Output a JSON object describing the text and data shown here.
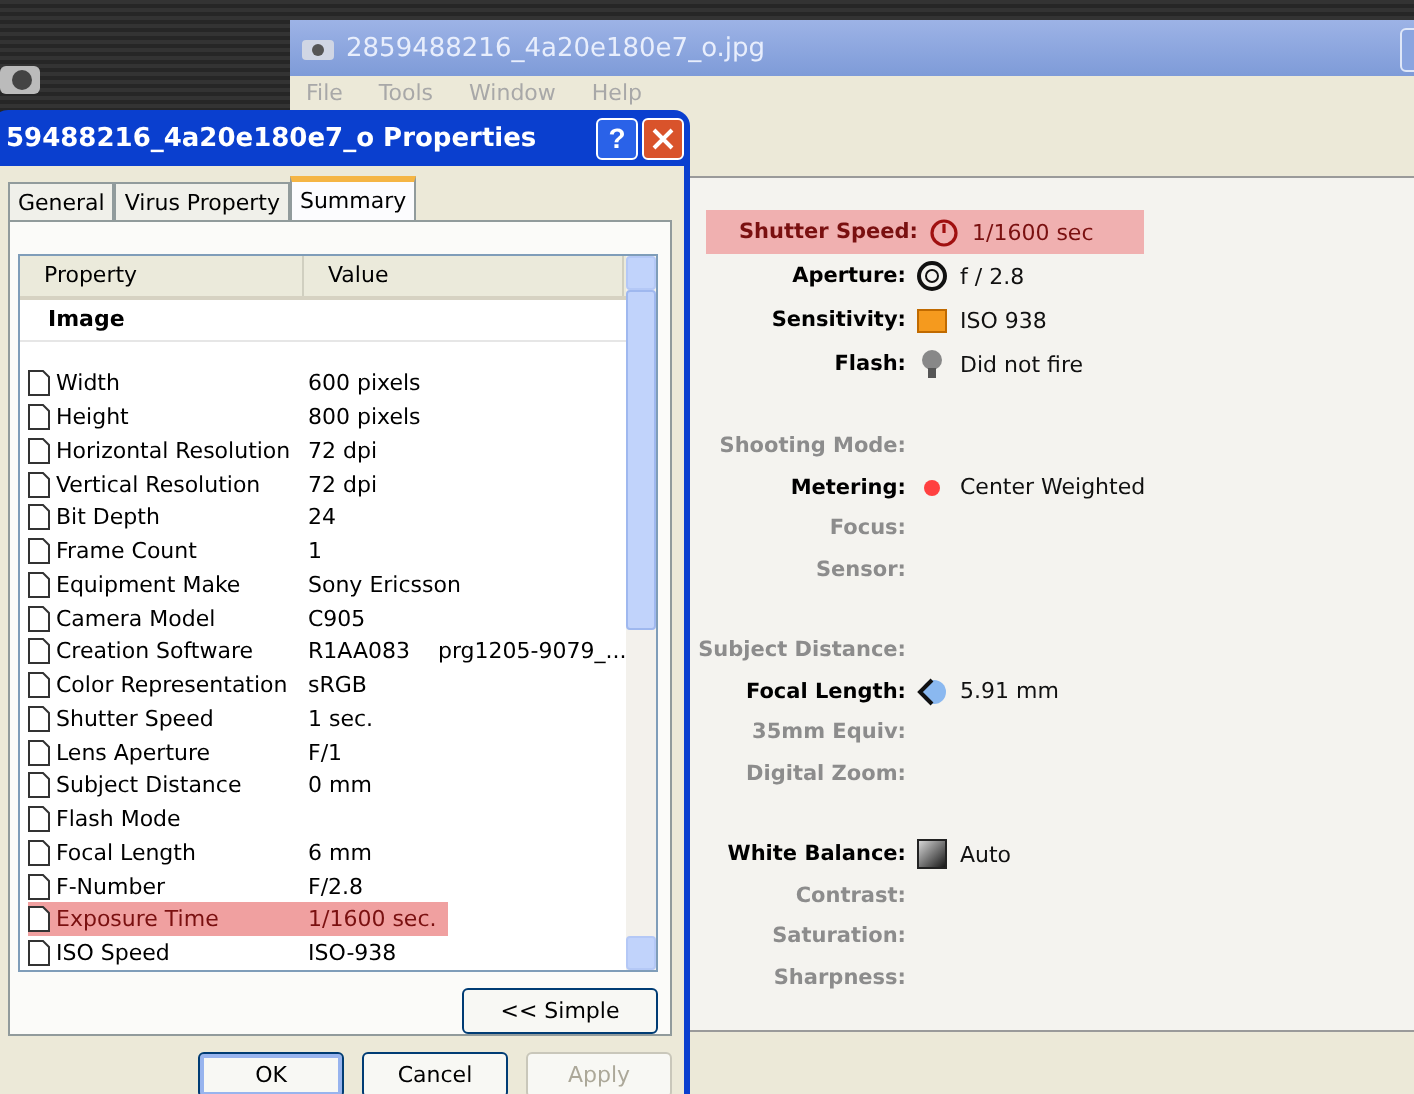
{
  "viewer": {
    "title": "2859488216_4a20e180e7_o.jpg",
    "menu": [
      "File",
      "Tools",
      "Window",
      "Help"
    ],
    "groups": [
      {
        "rows": [
          {
            "label": "Shutter Speed:",
            "kind": "shutter",
            "value": "1/1600 sec",
            "available": true,
            "highlighted": true
          },
          {
            "label": "Aperture:",
            "kind": "aperture",
            "value": "f / 2.8",
            "available": true,
            "highlighted": false
          },
          {
            "label": "Sensitivity:",
            "kind": "film",
            "value": "ISO 938",
            "available": true,
            "highlighted": false
          },
          {
            "label": "Flash:",
            "kind": "flash",
            "value": "Did not fire",
            "available": true,
            "highlighted": false
          }
        ]
      },
      {
        "rows": [
          {
            "label": "Shooting Mode:",
            "available": false,
            "highlighted": false
          },
          {
            "label": "Metering:",
            "kind": "metering",
            "value": "Center Weighted",
            "available": true,
            "highlighted": false
          },
          {
            "label": "Focus:",
            "available": false,
            "highlighted": false
          },
          {
            "label": "Sensor:",
            "available": false,
            "highlighted": false
          }
        ]
      },
      {
        "rows": [
          {
            "label": "Subject Distance:",
            "available": false,
            "highlighted": false
          },
          {
            "label": "Focal Length:",
            "kind": "focal",
            "value": "5.91 mm",
            "available": true,
            "highlighted": false
          },
          {
            "label": "35mm Equiv:",
            "available": false,
            "highlighted": false
          },
          {
            "label": "Digital Zoom:",
            "available": false,
            "highlighted": false
          }
        ]
      },
      {
        "rows": [
          {
            "label": "White Balance:",
            "kind": "white_balance",
            "value": "Auto",
            "available": true,
            "highlighted": false
          },
          {
            "label": "Contrast:",
            "available": false,
            "highlighted": false
          },
          {
            "label": "Saturation:",
            "available": false,
            "highlighted": false
          },
          {
            "label": "Sharpness:",
            "available": false,
            "highlighted": false
          }
        ]
      }
    ]
  },
  "dialog": {
    "title": "59488216_4a20e180e7_o Properties",
    "tabs": [
      {
        "label": "General",
        "selected": false
      },
      {
        "label": "Virus Property",
        "selected": false
      },
      {
        "label": "Summary",
        "selected": true
      }
    ],
    "columns": [
      "Property",
      "Value"
    ],
    "help_button": "?",
    "group": "Image",
    "rows": [
      {
        "name": "Width",
        "value": "600 pixels",
        "highlighted": false
      },
      {
        "name": "Height",
        "value": "800 pixels",
        "highlighted": false
      },
      {
        "name": "Horizontal Resolution",
        "value": "72 dpi",
        "highlighted": false
      },
      {
        "name": "Vertical Resolution",
        "value": "72 dpi",
        "highlighted": false
      },
      {
        "name": "Bit Depth",
        "value": "24",
        "highlighted": false
      },
      {
        "name": "Frame Count",
        "value": "1",
        "highlighted": false
      },
      {
        "name": "Equipment Make",
        "value": "Sony Ericsson",
        "highlighted": false
      },
      {
        "name": "Camera Model",
        "value": "C905",
        "highlighted": false
      },
      {
        "name": "Creation Software",
        "value": "R1AA083    prg1205-9079_...",
        "highlighted": false
      },
      {
        "name": "Color Representation",
        "value": "sRGB",
        "highlighted": false
      },
      {
        "name": "Shutter Speed",
        "value": "1 sec.",
        "highlighted": false
      },
      {
        "name": "Lens Aperture",
        "value": "F/1",
        "highlighted": false
      },
      {
        "name": "Subject Distance",
        "value": "0 mm",
        "highlighted": false
      },
      {
        "name": "Flash Mode",
        "highlighted": false
      },
      {
        "name": "Focal Length",
        "value": "6 mm",
        "highlighted": false
      },
      {
        "name": "F-Number",
        "value": "F/2.8",
        "highlighted": false
      },
      {
        "name": "Exposure Time",
        "value": "1/1600 sec.",
        "highlighted": true
      },
      {
        "name": "ISO Speed",
        "value": "ISO-938",
        "highlighted": false
      }
    ],
    "toggle_button": "<< Simple",
    "buttons": [
      {
        "label": "OK",
        "disabled": false,
        "default": true
      },
      {
        "label": "Cancel",
        "disabled": false,
        "default": false
      },
      {
        "label": "Apply",
        "disabled": true,
        "default": false
      }
    ]
  }
}
